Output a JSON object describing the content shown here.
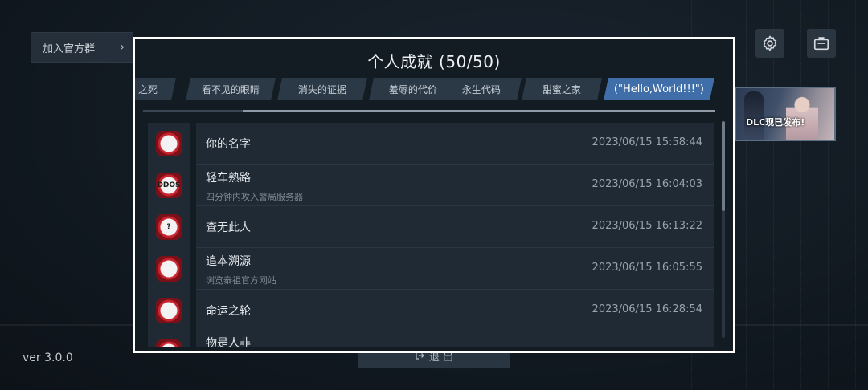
{
  "background": {
    "join_group": {
      "label": "加入官方群",
      "chevron": "›"
    },
    "dlc_banner": {
      "text": "DLC现已发布!"
    },
    "version": "ver 3.0.0",
    "exit_button": {
      "label": "退 出",
      "icon": "exit-icon"
    },
    "top_icons": [
      "settings-icon",
      "briefcase-icon"
    ]
  },
  "dialog": {
    "title": "个人成就 (50/50)",
    "tabs": [
      {
        "label": "之死",
        "active": false
      },
      {
        "label": "看不见的眼睛",
        "active": false
      },
      {
        "label": "消失的证据",
        "active": false
      },
      {
        "label": "羞辱的代价",
        "active": false
      },
      {
        "label": "永生代码",
        "active": false
      },
      {
        "label": "甜蜜之家",
        "active": false
      },
      {
        "label": "(\"Hello,World!!!\")",
        "active": true
      }
    ],
    "achievements": [
      {
        "name": "你的名字",
        "desc": "",
        "time": "2023/06/15 15:58:44",
        "icon": "portrait-icon",
        "icon_text": ""
      },
      {
        "name": "轻车熟路",
        "desc": "四分钟内攻入警局服务器",
        "time": "2023/06/15 16:04:03",
        "icon": "ddos-icon",
        "icon_text": "DDOS"
      },
      {
        "name": "查无此人",
        "desc": "",
        "time": "2023/06/15 16:13:22",
        "icon": "question-file-icon",
        "icon_text": "?"
      },
      {
        "name": "追本溯源",
        "desc": "浏览泰祖官方网站",
        "time": "2023/06/15 16:05:55",
        "icon": "cubes-icon",
        "icon_text": ""
      },
      {
        "name": "命运之轮",
        "desc": "",
        "time": "2023/06/15 16:28:54",
        "icon": "wheel-icon",
        "icon_text": ""
      },
      {
        "name": "物是人非",
        "desc": "",
        "time": "",
        "icon": "clock-icon",
        "icon_text": ""
      }
    ]
  },
  "colors": {
    "accent_tab": "#3f6ea8",
    "icon_red": "#c8242f",
    "dialog_border": "#ffffff"
  }
}
